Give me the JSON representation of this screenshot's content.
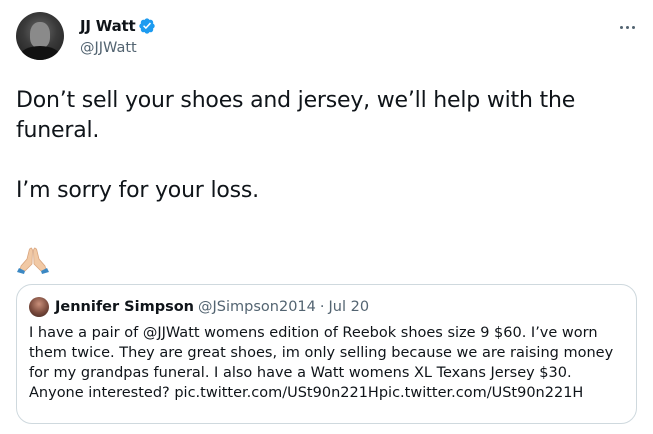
{
  "author": {
    "display_name": "JJ Watt",
    "handle": "@JJWatt",
    "verified": true
  },
  "tweet": {
    "text": "Don’t sell your shoes and jersey, we’ll help with the funeral.\n\nI’m sorry for your loss.",
    "emoji": "🙏🏼"
  },
  "quoted_tweet": {
    "display_name": "Jennifer Simpson",
    "handle": "@JSimpson2014",
    "separator": "·",
    "date": "Jul 20",
    "text": "I have a pair of @JJWatt womens edition of Reebok shoes size 9 $60. I’ve worn them twice. They are great shoes, im only selling because we are raising money for my grandpas funeral. I also have a Watt womens XL Texans Jersey $30. Anyone interested? pic.twitter.com/USt90n221Hpic.twitter.com/USt90n221H"
  },
  "icons": {
    "verified": "verified-badge-icon",
    "more": "more-options-icon",
    "emoji": "folded-hands-icon"
  },
  "colors": {
    "text_primary": "#0f1419",
    "text_secondary": "#536471",
    "verified_blue": "#1d9bf0",
    "border": "#cfd9de"
  }
}
